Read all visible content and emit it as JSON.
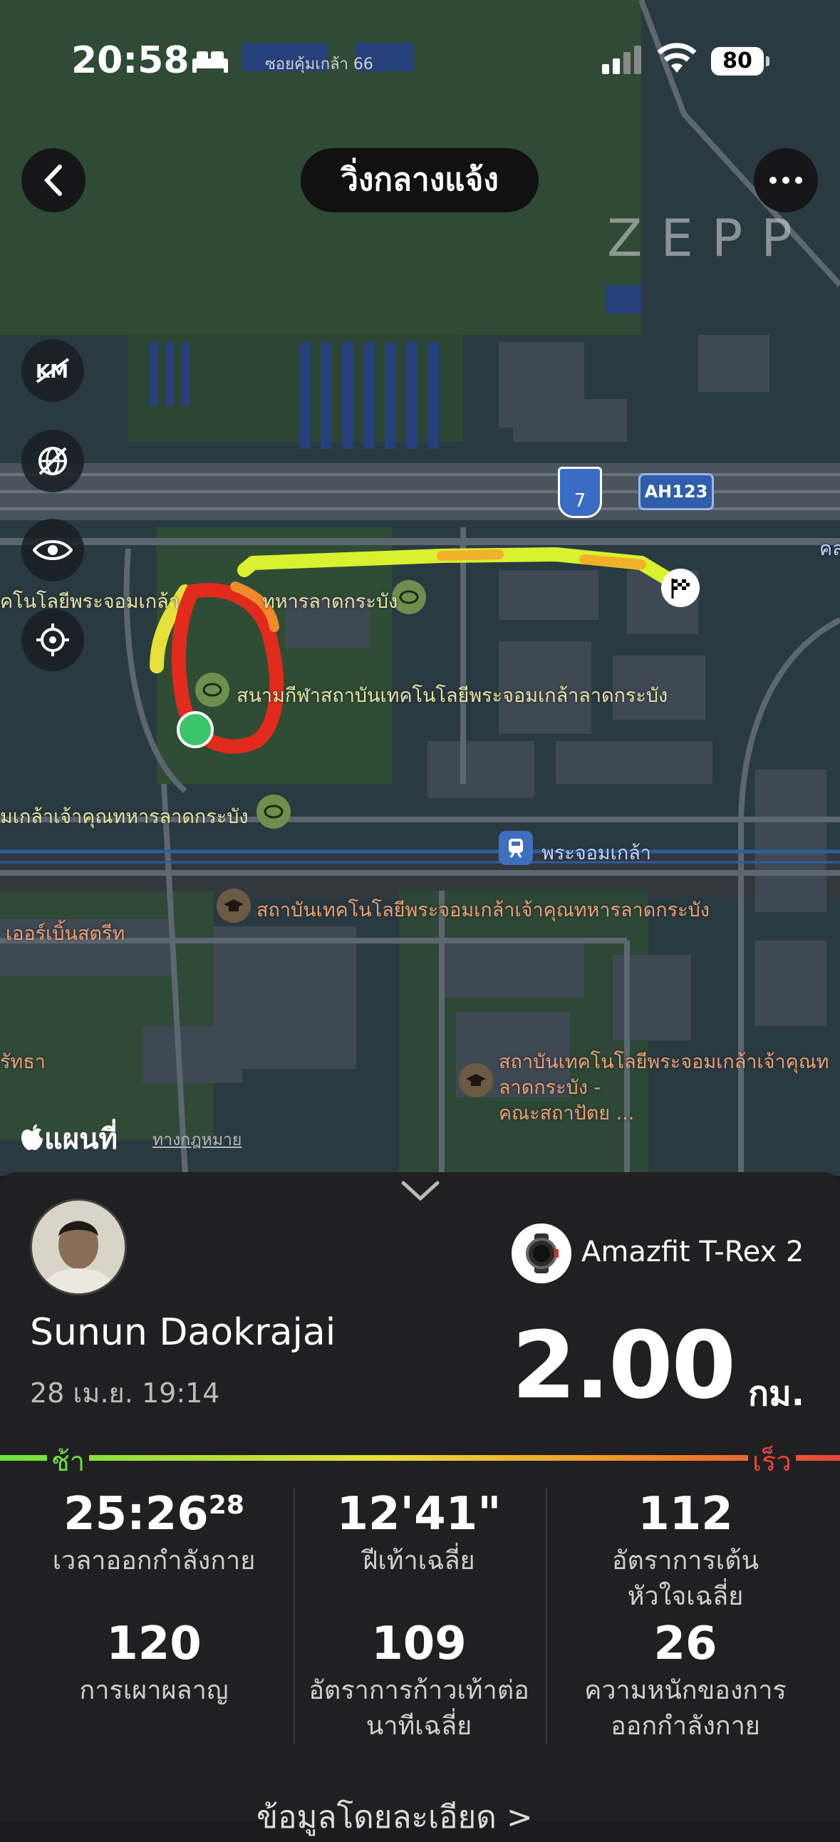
{
  "status_bar": {
    "time": "20:58",
    "location": "ซอยคุ้มเกล้า 66",
    "battery": "80"
  },
  "header": {
    "title": "วิ่งกลางแจ้ง",
    "watermark": "ZEPP"
  },
  "map_labels": {
    "stadium": "สนามกีฬาสถาบันเทคโนโลยีพระจอมเกล้าลาดกระบัง",
    "left_top": "คโนโลยีพระจอมเกล้า",
    "top_mid": "ทหารลาดกระบัง",
    "left_mid": "มเกล้าเจ้าคุณทหารลาดกระบัง",
    "station": "พระจอมเกล้า",
    "institute": "สถาบันเทคโนโลยีพระจอมเกล้าเจ้าคุณทหารลาดกระบัง",
    "street": "เออร์เบิ้นสตรีท",
    "left_bottom": "รัทธา",
    "faculty_line1": "สถาบันเทคโนโลยีพระจอมเกล้าเจ้าคุณท",
    "faculty_line2": "ลาดกระบัง -",
    "faculty_line3": "คณะสถาปัตย ...",
    "highway_shield": "7",
    "highway_ah": "AH123",
    "edge": "คล",
    "apple_maps": "แผนที่",
    "legal": "ทางกฎหมาย"
  },
  "summary": {
    "user_name": "Sunun Daokrajai",
    "date": "28 เม.ย. 19:14",
    "device": "Amazfit T-Rex 2",
    "distance": "2.00",
    "distance_unit": "กม.",
    "pace_slow": "ช้า",
    "pace_fast": "เร็ว"
  },
  "stats": [
    {
      "value": "25:26",
      "sup": "28",
      "label": "เวลาออกกำลังกาย"
    },
    {
      "value": "12'41\"",
      "label": "ฝีเท้าเฉลี่ย"
    },
    {
      "value": "112",
      "label1": "อัตราการเต้น",
      "label2": "หัวใจเฉลี่ย"
    },
    {
      "value": "120",
      "label": "การเผาผลาญ"
    },
    {
      "value": "109",
      "label1": "อัตราการก้าวเท้าต่อ",
      "label2": "นาทีเฉลี่ย"
    },
    {
      "value": "26",
      "label1": "ความหนักของการ",
      "label2": "ออกกำลังกาย"
    }
  ],
  "detail_link": "ข้อมูลโดยละเอียด >",
  "colors": {
    "route_slow": "#d6f03a",
    "route_fast": "#e02a1f",
    "start": "#3cc46b"
  }
}
